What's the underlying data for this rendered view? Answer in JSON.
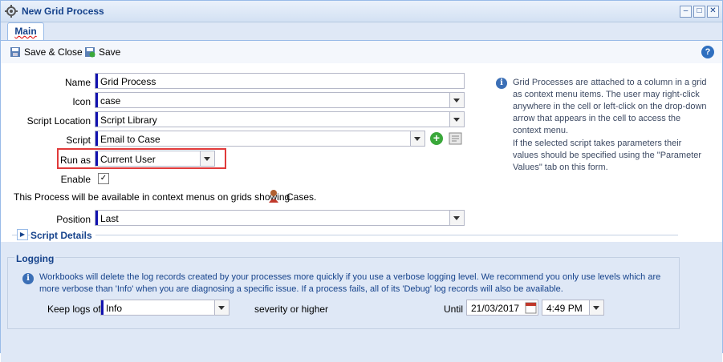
{
  "window": {
    "title": "New Grid Process"
  },
  "tabs": [
    {
      "label": "Main"
    }
  ],
  "toolbar": {
    "save_close_label": "Save & Close",
    "save_label": "Save"
  },
  "form": {
    "name": {
      "label": "Name",
      "value": "Grid Process"
    },
    "icon": {
      "label": "Icon",
      "value": "case"
    },
    "script_location": {
      "label": "Script Location",
      "value": "Script Library"
    },
    "script": {
      "label": "Script",
      "value": "Email to Case"
    },
    "run_as": {
      "label": "Run as",
      "value": "Current User"
    },
    "enable": {
      "label": "Enable",
      "checked": true
    },
    "availability_prefix": "This Process will be available in context menus on grids showing",
    "availability_entity": "Cases.",
    "position": {
      "label": "Position",
      "value": "Last"
    },
    "script_details_label": "Script Details"
  },
  "info_panel": {
    "paragraph1": "Grid Processes are attached to a column in a grid as context menu items. The user may right-click anywhere in the cell or left-click on the drop-down arrow that appears in the cell to access the context menu.",
    "paragraph2": "If the selected script takes parameters their values should be specified using the \"Parameter Values\" tab on this form."
  },
  "logging": {
    "legend": "Logging",
    "info": "Workbooks will delete the log records created by your processes more quickly if you use a verbose logging level. We recommend you only use levels which are more verbose than 'Info' when you are diagnosing a specific issue. If a process fails, all of its 'Debug' log records will also be available.",
    "keep_logs_label": "Keep logs of",
    "level_value": "Info",
    "severity_text": "severity or higher",
    "until_label": "Until",
    "date_value": "21/03/2017",
    "time_value": "4:49 PM"
  },
  "colors": {
    "accent": "#15428b",
    "highlight": "#e03a3a",
    "mandatory_marker": "#1212b0"
  }
}
